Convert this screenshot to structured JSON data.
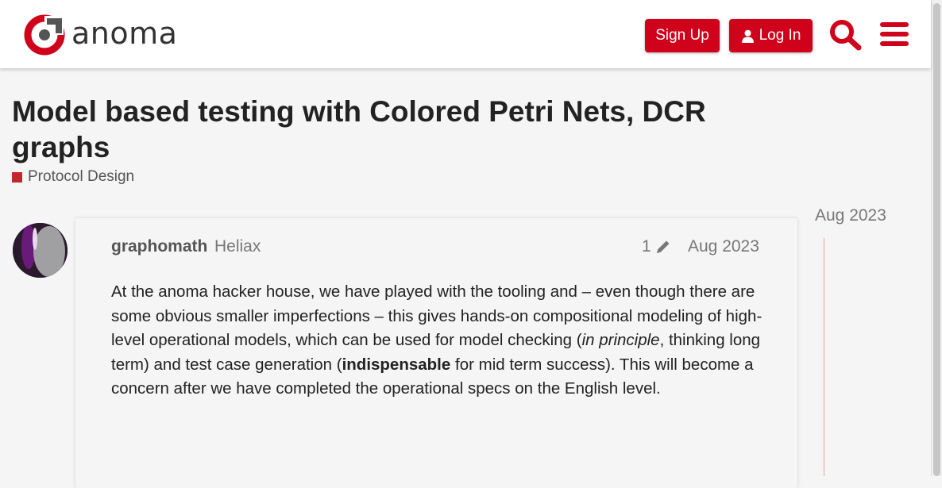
{
  "header": {
    "logo_text": "anoma",
    "signup_label": "Sign Up",
    "login_label": "Log In",
    "icons": {
      "search": "search-icon",
      "menu": "hamburger-menu-icon",
      "login": "user-icon",
      "logo": "anoma-logo-icon"
    },
    "brand_color": "#d0021b"
  },
  "topic": {
    "title": "Model based testing with Colored Petri Nets, DCR graphs",
    "category": "Protocol Design",
    "category_color": "#c1272d"
  },
  "post": {
    "username": "graphomath",
    "user_title": "Heliax",
    "edit_count": "1",
    "date": "Aug 2023",
    "body": {
      "p1": "At the anoma hacker house, we have played with the tooling and – even though there are some obvious smaller imperfections – this gives hands-on compositional modeling of high-level operational models, which can be used for model checking (",
      "em1": "in principle",
      "p2": ", thinking long term) and test case generation (",
      "strong1": "indispensable",
      "p3": " for mid term success). This will become a concern after we have completed the operational specs on the English level."
    }
  },
  "timeline": {
    "date": "Aug 2023"
  }
}
